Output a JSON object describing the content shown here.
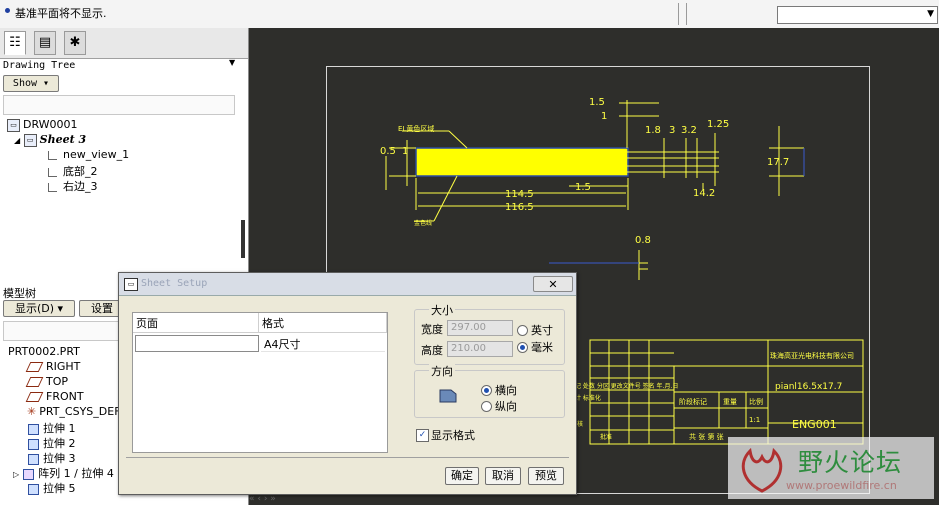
{
  "message_bar": {
    "text": "基准平面将不显示."
  },
  "drawing_tree": {
    "label": "Drawing Tree",
    "show_button": "Show",
    "items": [
      {
        "label": "DRW0001"
      },
      {
        "label": "Sheet 3"
      },
      {
        "label": "new_view_1"
      },
      {
        "label": "底部_2"
      },
      {
        "label": "右边_3"
      }
    ]
  },
  "model_tree": {
    "label": "模型树",
    "show_button": "显示(D)",
    "settings_button": "设置",
    "items": [
      {
        "label": "PRT0002.PRT"
      },
      {
        "label": "RIGHT"
      },
      {
        "label": "TOP"
      },
      {
        "label": "FRONT"
      },
      {
        "label": "PRT_CSYS_DEF"
      },
      {
        "label": "拉伸 1"
      },
      {
        "label": "拉伸 2"
      },
      {
        "label": "拉伸 3"
      },
      {
        "label": "阵列 1 / 拉伸 4"
      },
      {
        "label": "拉伸 5"
      }
    ]
  },
  "drawing": {
    "dims": {
      "d1_5_top": "1.5",
      "d1_top": "1",
      "d1_8": "1.8",
      "d3": "3",
      "d3_2": "3.2",
      "d1_25": "1.25",
      "d0_5": "0.5",
      "d1_left": "1",
      "d17_7": "17.7",
      "d1_5_mid": "1.5",
      "d114_5": "114.5",
      "d116_5": "116.5",
      "d14_2": "14.2",
      "d0_8": "0.8"
    },
    "labels": {
      "el_label": "EL黄色区域",
      "left_label": "金色线"
    },
    "title_block": {
      "company": "珠海高亚光电科技有限公司",
      "part": "pianl16.5x17.7",
      "code": "ENG001",
      "scale_label": "比例",
      "weight_label": "重量",
      "stage_label": "阶段标记",
      "scale_value": "1:1",
      "sheets_text": "共 张 第 张",
      "rev_cols": "标记 处数 分区 更改文件号 签名 年.月.日",
      "design_row": "设计 标准化",
      "review_row": "审核",
      "approve_row": "批准"
    }
  },
  "dialog": {
    "title": "Sheet Setup",
    "close": "✕",
    "columns": [
      "页面",
      "格式"
    ],
    "row": {
      "page": "",
      "format": "A4尺寸"
    },
    "size_group": "大小",
    "width_label": "宽度",
    "width_value": "297.00",
    "height_label": "高度",
    "height_value": "210.00",
    "unit_inch": "英寸",
    "unit_mm": "毫米",
    "selected_unit": "mm",
    "orientation_group": "方向",
    "orient_landscape": "横向",
    "orient_portrait": "纵向",
    "selected_orientation": "landscape",
    "show_format_label": "显示格式",
    "show_format_checked": true,
    "buttons": {
      "ok": "确定",
      "cancel": "取消",
      "preview": "预览"
    }
  },
  "watermark": {
    "title": "野火论坛",
    "url": "www.proewildfire.cn"
  },
  "colors": {
    "canvas_bg": "#2e2e2b",
    "part_fill": "#ffff00",
    "part_edge": "#2a4aa0",
    "dim_color": "#ffff44",
    "watermark_green": "#2f8d3f"
  }
}
